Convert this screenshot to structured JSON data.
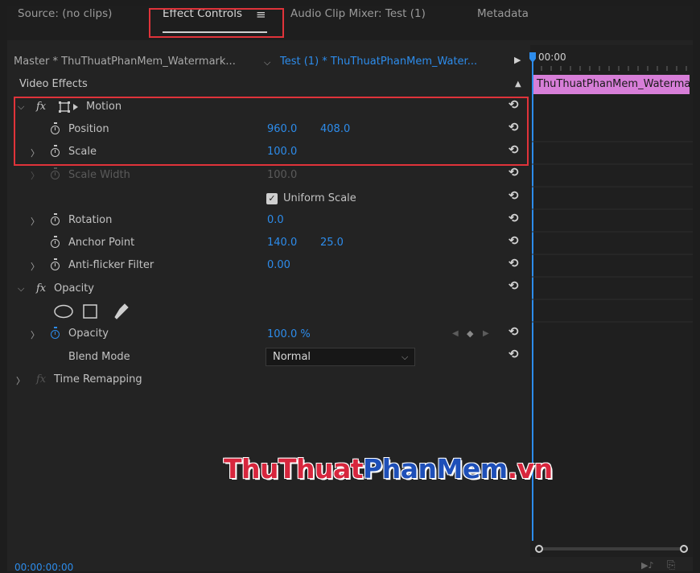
{
  "tabs": {
    "source": "Source: (no clips)",
    "effect_controls": "Effect Controls",
    "menu_glyph": "≡",
    "audio_mixer": "Audio Clip Mixer: Test (1)",
    "metadata": "Metadata"
  },
  "header": {
    "master_label": "Master * ThuThuatPhanMem_Watermark...",
    "sequence_label": "Test (1) * ThuThuatPhanMem_Water...",
    "timecode_ruler": "00:00"
  },
  "timeline": {
    "clip_name": "ThuThuatPhanMem_Watermark"
  },
  "section": {
    "title": "Video Effects"
  },
  "motion": {
    "title": "Motion",
    "position": {
      "label": "Position",
      "x": "960.0",
      "y": "408.0"
    },
    "scale": {
      "label": "Scale",
      "value": "100.0"
    },
    "scale_width": {
      "label": "Scale Width",
      "value": "100.0"
    },
    "uniform_scale": {
      "label": "Uniform Scale",
      "checked": true
    },
    "rotation": {
      "label": "Rotation",
      "value": "0.0"
    },
    "anchor_point": {
      "label": "Anchor Point",
      "x": "140.0",
      "y": "25.0"
    },
    "anti_flicker": {
      "label": "Anti-flicker Filter",
      "value": "0.00"
    }
  },
  "opacity": {
    "title": "Opacity",
    "opacity": {
      "label": "Opacity",
      "value": "100.0 %"
    },
    "blend_mode": {
      "label": "Blend Mode",
      "value": "Normal"
    }
  },
  "time_remapping": {
    "title": "Time Remapping"
  },
  "footer": {
    "timecode": "00:00:00:00"
  },
  "watermark": {
    "part1": "ThuThuat",
    "part2": "PhanMem",
    "part3": ".vn"
  },
  "colors": {
    "accent_blue": "#2d8ceb",
    "highlight_red": "#e0333a",
    "clip_pink": "#d77ed8",
    "panel_bg": "#232323"
  }
}
